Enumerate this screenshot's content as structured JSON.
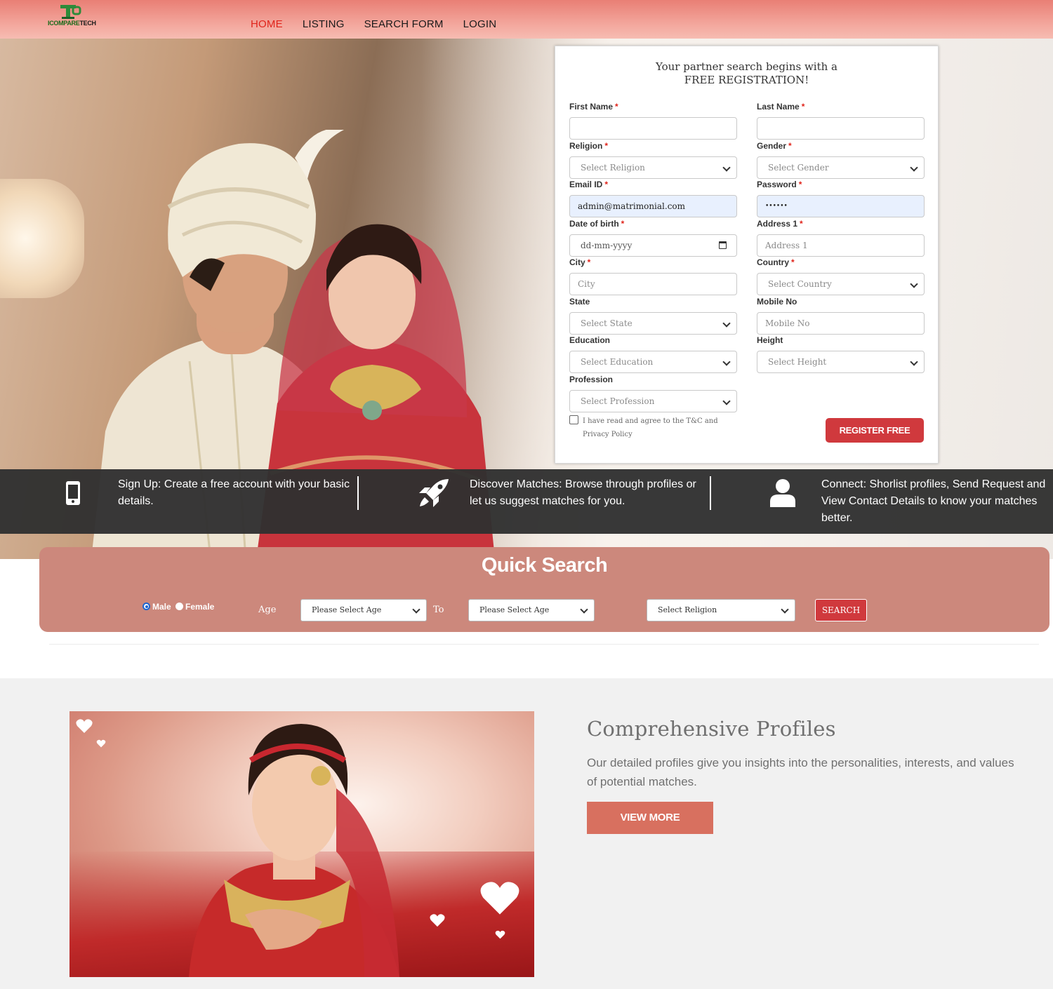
{
  "header": {
    "logo_text_1": "ICOMPARE",
    "logo_text_2": "TECH",
    "nav": [
      {
        "label": "HOME",
        "active": true
      },
      {
        "label": "LISTING",
        "active": false
      },
      {
        "label": "SEARCH FORM",
        "active": false
      },
      {
        "label": "LOGIN",
        "active": false
      }
    ]
  },
  "registration": {
    "title_line1": "Your partner search begins with a",
    "title_line2": "FREE REGISTRATION!",
    "required_mark": "*",
    "fields": {
      "first_name": {
        "label": "First Name",
        "value": ""
      },
      "last_name": {
        "label": "Last Name",
        "value": ""
      },
      "religion": {
        "label": "Religion",
        "value": "Select Religion"
      },
      "gender": {
        "label": "Gender",
        "value": "Select Gender"
      },
      "email": {
        "label": "Email ID",
        "value": "admin@matrimonial.com"
      },
      "password": {
        "label": "Password",
        "value": "••••••"
      },
      "dob": {
        "label": "Date of birth",
        "placeholder": "dd-mm-yyyy"
      },
      "address1": {
        "label": "Address 1",
        "placeholder": "Address 1"
      },
      "city": {
        "label": "City",
        "placeholder": "City"
      },
      "country": {
        "label": "Country",
        "value": "Select Country"
      },
      "state": {
        "label": "State",
        "value": "Select State"
      },
      "mobile": {
        "label": "Mobile No",
        "placeholder": "Mobile No"
      },
      "education": {
        "label": "Education",
        "value": "Select Education"
      },
      "height": {
        "label": "Height",
        "value": "Select Height"
      },
      "profession": {
        "label": "Profession",
        "value": "Select Profession"
      }
    },
    "terms_line1": "I have read and agree to the T&C and",
    "terms_line2": "Privacy Policy",
    "submit_label": "REGISTER FREE"
  },
  "steps": [
    {
      "icon": "mobile-phone-icon",
      "text_line1": "Sign Up: Create a free account with your basic",
      "text_line2": "details.",
      "text_line3": ""
    },
    {
      "icon": "rocket-icon",
      "text_line1": "Discover Matches: Browse through profiles or",
      "text_line2": "let us suggest matches for you.",
      "text_line3": ""
    },
    {
      "icon": "user-icon",
      "text_line1": "Connect: Shorlist profiles, Send Request and",
      "text_line2": "View Contact Details to know your matches",
      "text_line3": "better."
    }
  ],
  "quick_search": {
    "title": "Quick Search",
    "gender_options": [
      "Male",
      "Female"
    ],
    "gender_selected": "Male",
    "age_label": "Age",
    "age_from": "Please Select Age",
    "to_label": "To",
    "age_to": "Please Select Age",
    "religion": "Select Religion",
    "search_label": "SEARCH"
  },
  "profiles": {
    "title": "Comprehensive Profiles",
    "text": "Our detailed profiles give you insights into the personalities, interests, and values of potential matches.",
    "button": "VIEW MORE"
  },
  "colors": {
    "accent_red": "#d0393d",
    "nav_active": "#e0241b",
    "header_pink": "#f4aba1",
    "quick_search_bg": "#cc887c",
    "view_more_bg": "#d8705f"
  }
}
